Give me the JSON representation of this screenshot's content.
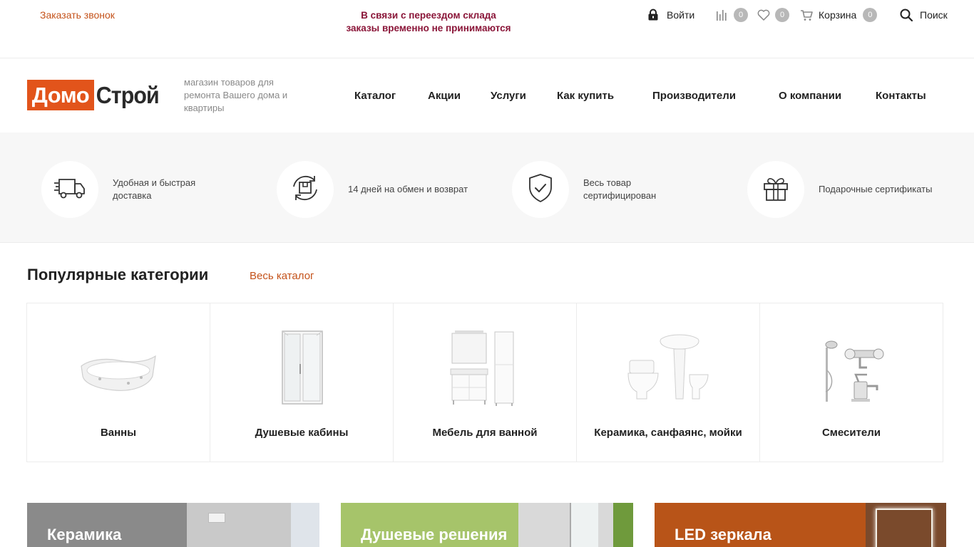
{
  "topbar": {
    "callback": "Заказать звонок",
    "notice_line1": "В связи с переездом склада",
    "notice_line2": "заказы временно не принимаются",
    "login": "Войти",
    "compare_count": "0",
    "favorites_count": "0",
    "cart_label": "Корзина",
    "cart_count": "0",
    "search_label": "Поиск"
  },
  "header": {
    "logo_part1": "Домо",
    "logo_part2": "Строй",
    "tagline": "магазин товаров для ремонта Вашего дома и квартиры",
    "nav": [
      "Каталог",
      "Акции",
      "Услуги",
      "Как купить",
      "Производители",
      "О компании",
      "Контакты"
    ]
  },
  "benefits": [
    {
      "icon": "delivery-truck-icon",
      "text": "Удобная и быстрая доставка"
    },
    {
      "icon": "return-exchange-icon",
      "text": "14 дней на обмен и возврат"
    },
    {
      "icon": "certified-shield-icon",
      "text": "Весь товар сертифицирован"
    },
    {
      "icon": "gift-icon",
      "text": "Подарочные сертификаты"
    }
  ],
  "popular": {
    "title": "Популярные категории",
    "all_link": "Весь каталог",
    "categories": [
      "Ванны",
      "Душевые кабины",
      "Мебель для ванной",
      "Керамика, санфаянс, мойки",
      "Смесители"
    ]
  },
  "banners": [
    {
      "text": "Керамика"
    },
    {
      "text": "Душевые решения"
    },
    {
      "text": "LED зеркала"
    }
  ],
  "colors": {
    "accent": "#c4521a",
    "logo_orange": "#e2541b",
    "notice": "#8a1538",
    "banner1": "#8a8a8a",
    "banner2": "#a6c46a",
    "banner3": "#b85418"
  }
}
